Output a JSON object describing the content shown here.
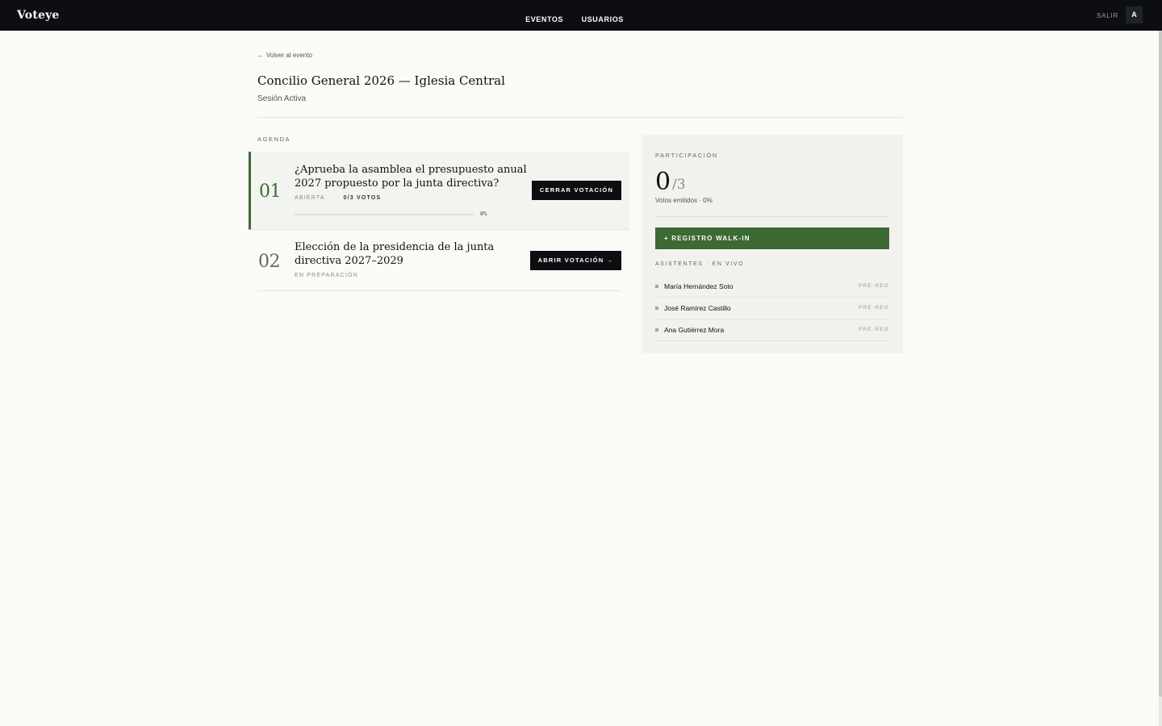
{
  "app": {
    "brand": "Voteye"
  },
  "nav": {
    "items": [
      "EVENTOS",
      "USUARIOS"
    ],
    "logout": "SALIR",
    "avatar_initial": "A"
  },
  "header": {
    "back_arrow": "←",
    "back_label": "Volver al evento",
    "title": "Concilio General 2026 — Iglesia Central",
    "subtitle": "Sesión Activa"
  },
  "agenda": {
    "label": "AGENDA",
    "items": [
      {
        "number": "01",
        "title": "¿Aprueba la asamblea el presupuesto anual 2027 propuesto por la junta directiva?",
        "status": "ABIERTA",
        "votes_dot": "·",
        "votes": "0/3 VOTOS",
        "progress": 0,
        "percent": "0%",
        "button": "CERRAR VOTACIÓN"
      },
      {
        "number": "02",
        "title": "Elección de la presidencia de la junta directiva 2027–2029",
        "status": "EN PREPARACIÓN",
        "button": "ABRIR VOTACIÓN →"
      }
    ]
  },
  "participation": {
    "label": "PARTICIPACIÓN",
    "count": "0",
    "total": "/3",
    "summary": "Votos emitidos · 0%",
    "walkin_button": "+ REGISTRO WALK-IN",
    "attendees_label": "ASISTENTES · EN VIVO",
    "attendees": [
      {
        "name": "María Hernández Soto",
        "tag": "PRE-REG"
      },
      {
        "name": "José Ramírez Castillo",
        "tag": "PRE-REG"
      },
      {
        "name": "Ana Gutiérrez Mora",
        "tag": "PRE-REG"
      }
    ]
  },
  "colors": {
    "accent": "#3b6a35",
    "topbar": "#0c0e12",
    "panel": "#f3f1ec"
  }
}
